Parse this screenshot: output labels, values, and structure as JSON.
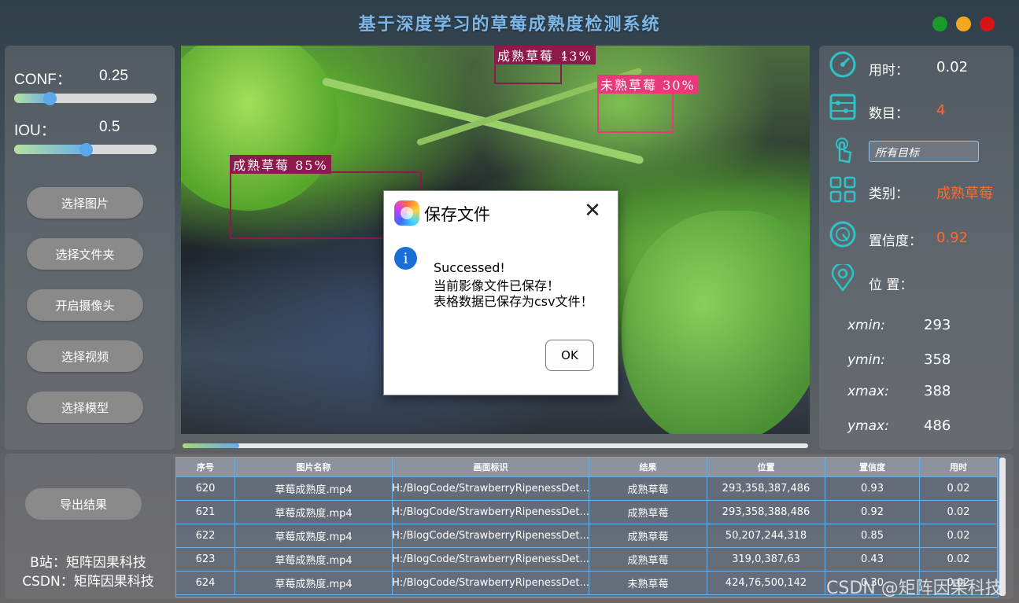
{
  "app": {
    "title": "基于深度学习的草莓成熟度检测系统",
    "window_controls": {
      "minimize_color": "#1a9a2a",
      "maximize_color": "#f2a81c",
      "close_color": "#d71313"
    }
  },
  "params": {
    "conf": {
      "label": "CONF：",
      "value": "0.25",
      "level": 0.25
    },
    "iou": {
      "label": "IOU：",
      "value": "0.5",
      "level": 0.5
    }
  },
  "left_buttons": {
    "select_image": "选择图片",
    "select_folder": "选择文件夹",
    "open_camera": "开启摄像头",
    "select_video": "选择视频",
    "select_model": "选择模型"
  },
  "detections": [
    {
      "label": "成熟草莓 43%",
      "class": "ripe",
      "color": "#8c1a4a"
    },
    {
      "label": "未熟草莓 30%",
      "class": "unripe",
      "color": "#e83a7a"
    },
    {
      "label": "成熟草莓 85%",
      "class": "ripe",
      "color": "#8c1a4a"
    }
  ],
  "progress": {
    "fraction": 0.09
  },
  "info": {
    "time_label": "用时：",
    "time_value": "0.02",
    "count_label": "数目：",
    "count_value": "4",
    "target_select": "所有目标",
    "class_label": "类别：",
    "class_value": "成熟草莓",
    "conf_label": "置信度：",
    "conf_value": "0.92",
    "position_label": "位 置：",
    "xmin_label": "xmin:",
    "xmin_value": "293",
    "ymin_label": "ymin:",
    "ymin_value": "358",
    "xmax_label": "xmax:",
    "xmax_value": "388",
    "ymax_label": "ymax:",
    "ymax_value": "486",
    "accent_color": "#ff6a2a",
    "icon_color": "#2ec3c8"
  },
  "bottom": {
    "export_button": "导出结果",
    "credit_bilibili": "B站：矩阵因果科技",
    "credit_csdn": "CSDN：矩阵因果科技",
    "watermark": "CSDN @矩阵因果科技"
  },
  "table": {
    "columns": [
      "序号",
      "图片名称",
      "画面标识",
      "结果",
      "位置",
      "置信度",
      "用时"
    ],
    "rows": [
      [
        "620",
        "草莓成熟度.mp4",
        "H:/BlogCode/StrawberryRipenessDet...",
        "成熟草莓",
        "293,358,387,486",
        "0.93",
        "0.02"
      ],
      [
        "621",
        "草莓成熟度.mp4",
        "H:/BlogCode/StrawberryRipenessDet...",
        "成熟草莓",
        "293,358,388,486",
        "0.92",
        "0.02"
      ],
      [
        "622",
        "草莓成熟度.mp4",
        "H:/BlogCode/StrawberryRipenessDet...",
        "成熟草莓",
        "50,207,244,318",
        "0.85",
        "0.02"
      ],
      [
        "623",
        "草莓成熟度.mp4",
        "H:/BlogCode/StrawberryRipenessDet...",
        "成熟草莓",
        "319,0,387,63",
        "0.43",
        "0.02"
      ],
      [
        "624",
        "草莓成熟度.mp4",
        "H:/BlogCode/StrawberryRipenessDet...",
        "未熟草莓",
        "424,76,500,142",
        "0.30",
        "0.02"
      ]
    ]
  },
  "dialog": {
    "title": "保存文件",
    "line1": "Successed!",
    "line2": "当前影像文件已保存！",
    "line3": "表格数据已保存为csv文件！",
    "ok": "OK",
    "close_glyph": "✕",
    "info_glyph": "i"
  }
}
